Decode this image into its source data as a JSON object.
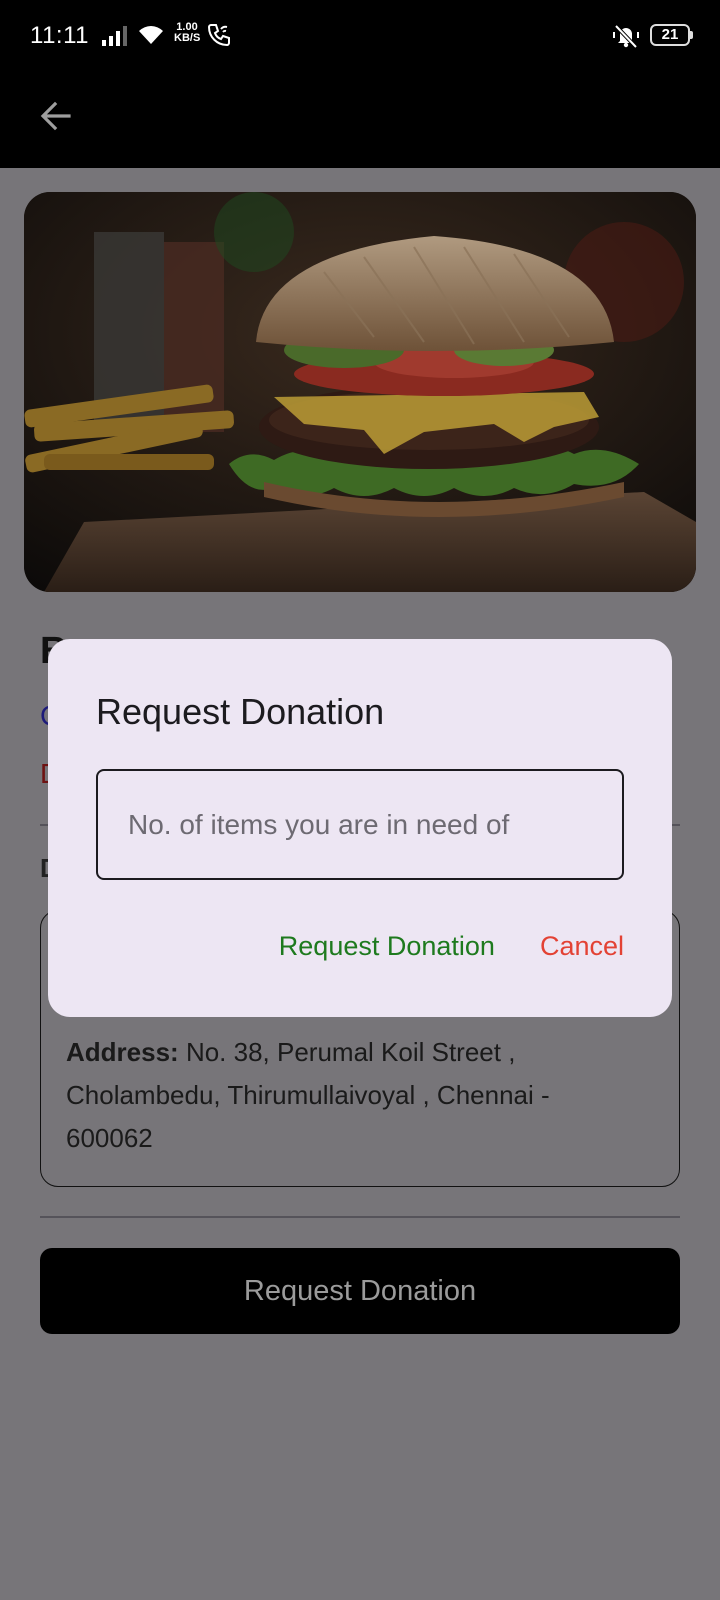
{
  "status_bar": {
    "time": "11:11",
    "net_speed_value": "1.00",
    "net_speed_unit": "KB/S",
    "battery_level": "21"
  },
  "background": {
    "title": "B",
    "subtitle_1": "C",
    "subtitle_2": "D",
    "section_label": "D",
    "address_label": "Address:",
    "address_value": "No. 38, Perumal Koil Street , Cholambedu, Thirumullaivoyal , Chennai  - 600062",
    "request_button_label": "Request Donation"
  },
  "dialog": {
    "title": "Request Donation",
    "input_placeholder": "No. of items you are in need of",
    "input_value": "",
    "confirm_label": "Request Donation",
    "cancel_label": "Cancel"
  },
  "colors": {
    "confirm": "#1e7a1e",
    "cancel": "#e34234",
    "dialog_bg": "#ede6f3",
    "scrim": "#777579"
  }
}
